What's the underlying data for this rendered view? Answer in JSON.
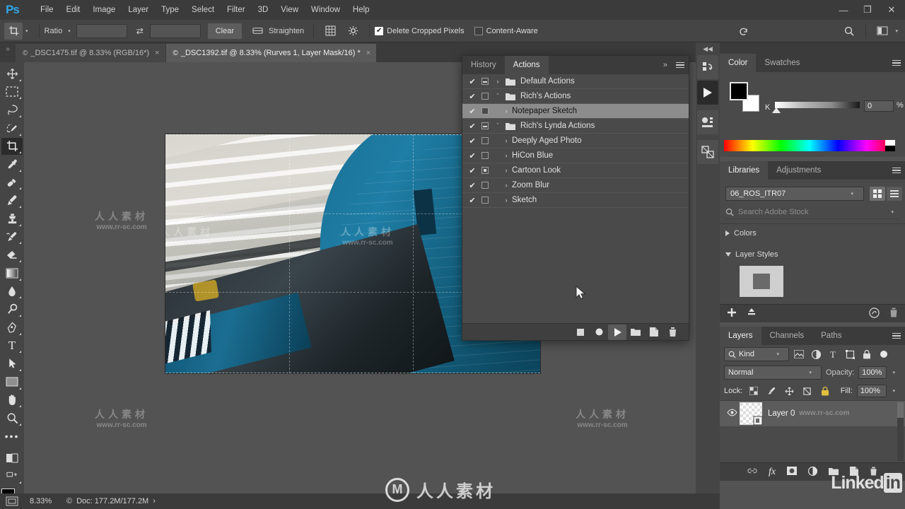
{
  "app": {
    "name": "Adobe Photoshop",
    "logo_text": "Ps"
  },
  "menubar": {
    "items": [
      {
        "label": "File"
      },
      {
        "label": "Edit"
      },
      {
        "label": "Image"
      },
      {
        "label": "Layer"
      },
      {
        "label": "Type"
      },
      {
        "label": "Select"
      },
      {
        "label": "Filter"
      },
      {
        "label": "3D"
      },
      {
        "label": "View"
      },
      {
        "label": "Window"
      },
      {
        "label": "Help"
      }
    ],
    "window_controls": {
      "minimize": "—",
      "restore": "❐",
      "close": "✕"
    }
  },
  "options_bar": {
    "tool_name": "crop-tool",
    "ratio_label": "Ratio",
    "width_value": "",
    "height_value": "",
    "swap_icon": "swap-arrows-icon",
    "clear_label": "Clear",
    "straighten_label": "Straighten",
    "overlay_icon": "crop-overlay-grid-icon",
    "settings_icon": "gear-icon",
    "delete_cropped_label": "Delete Cropped Pixels",
    "delete_cropped_checked": true,
    "content_aware_label": "Content-Aware",
    "content_aware_checked": false,
    "reset_icon": "reset-arrow-icon",
    "search_icon": "search-icon",
    "workspace_icon": "workspace-switcher-icon"
  },
  "tabs": {
    "collapse_icon": "expand-arrows-icon",
    "documents": [
      {
        "title": "_DSC1475.tif @ 8.33% (RGB/16*)",
        "cloud_mark": "©",
        "active": false,
        "close": "×"
      },
      {
        "title": "_DSC1392.tif @ 8.33% (Rurves 1, Layer Mask/16) *",
        "cloud_mark": "©",
        "active": true,
        "close": "×"
      }
    ]
  },
  "toolbox": {
    "tools": [
      {
        "name": "move-tool",
        "active": false
      },
      {
        "name": "rectangular-marquee-tool",
        "active": false
      },
      {
        "name": "lasso-tool",
        "active": false
      },
      {
        "name": "quick-selection-tool",
        "active": false
      },
      {
        "name": "crop-tool",
        "active": true
      },
      {
        "name": "eyedropper-tool",
        "active": false
      },
      {
        "name": "spot-healing-brush-tool",
        "active": false
      },
      {
        "name": "brush-tool",
        "active": false
      },
      {
        "name": "clone-stamp-tool",
        "active": false
      },
      {
        "name": "history-brush-tool",
        "active": false
      },
      {
        "name": "eraser-tool",
        "active": false
      },
      {
        "name": "gradient-tool",
        "active": false
      },
      {
        "name": "blur-tool",
        "active": false
      },
      {
        "name": "dodge-tool",
        "active": false
      },
      {
        "name": "pen-tool",
        "active": false
      },
      {
        "name": "type-tool",
        "active": false
      },
      {
        "name": "path-selection-tool",
        "active": false
      },
      {
        "name": "rectangle-tool",
        "active": false
      },
      {
        "name": "hand-tool",
        "active": false
      },
      {
        "name": "zoom-tool",
        "active": false
      },
      {
        "name": "edit-toolbar-tool",
        "active": false
      }
    ],
    "quickmask_icon": "quick-mask-icon",
    "screenmode_icon": "screen-mode-icon",
    "foreground_color": "#000000",
    "background_color": "#ffffff"
  },
  "actions_panel": {
    "tabs": [
      {
        "label": "History",
        "active": false
      },
      {
        "label": "Actions",
        "active": true
      }
    ],
    "chevrons": "»",
    "menu_icon": "panel-menu-icon",
    "rows": [
      {
        "label": "Default Actions",
        "checked": true,
        "box": "minus",
        "arrow": "›",
        "is_folder": true,
        "expanded": false,
        "highlight": false
      },
      {
        "label": "Rich's Actions",
        "checked": true,
        "box": "empty",
        "arrow": "ˇ",
        "is_folder": true,
        "expanded": true,
        "highlight": false
      },
      {
        "label": "Notepaper Sketch",
        "checked": true,
        "box": "empty",
        "arrow": "›",
        "is_folder": false,
        "expanded": false,
        "highlight": true
      },
      {
        "label": "Rich's Lynda Actions",
        "checked": true,
        "box": "minus",
        "arrow": "ˇ",
        "is_folder": true,
        "expanded": true,
        "highlight": false
      },
      {
        "label": "Deeply Aged Photo",
        "checked": true,
        "box": "empty",
        "arrow": "›",
        "is_folder": false,
        "expanded": false,
        "highlight": false
      },
      {
        "label": "HiCon Blue",
        "checked": true,
        "box": "empty",
        "arrow": "›",
        "is_folder": false,
        "expanded": false,
        "highlight": false
      },
      {
        "label": "Cartoon Look",
        "checked": true,
        "box": "filled",
        "arrow": "›",
        "is_folder": false,
        "expanded": false,
        "highlight": false
      },
      {
        "label": "Zoom Blur",
        "checked": true,
        "box": "empty",
        "arrow": "›",
        "is_folder": false,
        "expanded": false,
        "highlight": false
      },
      {
        "label": "Sketch",
        "checked": true,
        "box": "empty",
        "arrow": "›",
        "is_folder": false,
        "expanded": false,
        "highlight": false
      }
    ],
    "footer_buttons": [
      {
        "name": "stop-recording-button",
        "icon": "stop-square-icon",
        "active": false
      },
      {
        "name": "begin-recording-button",
        "icon": "record-circle-icon",
        "active": false
      },
      {
        "name": "play-selection-button",
        "icon": "play-triangle-icon",
        "active": true
      },
      {
        "name": "create-new-set-button",
        "icon": "folder-icon",
        "active": false
      },
      {
        "name": "create-new-action-button",
        "icon": "new-page-icon",
        "active": false
      },
      {
        "name": "delete-button",
        "icon": "trash-icon",
        "active": false
      }
    ]
  },
  "dock_rail": {
    "collapse_icon": "collapse-double-arrow-icon",
    "buttons": [
      {
        "name": "history-panel-icon",
        "active": false
      },
      {
        "name": "actions-panel-icon",
        "active": true
      },
      {
        "name": "properties-panel-icon",
        "active": false
      },
      {
        "name": "styles-panel-icon",
        "active": false
      }
    ]
  },
  "color_panel": {
    "tabs": [
      {
        "label": "Color",
        "active": true
      },
      {
        "label": "Swatches",
        "active": false
      }
    ],
    "menu_icon": "panel-menu-icon",
    "channel_label": "K",
    "channel_value": "0",
    "percent_symbol": "%",
    "foreground_color": "#000000",
    "background_color": "#ffffff"
  },
  "libraries_panel": {
    "tabs": [
      {
        "label": "Libraries",
        "active": true
      },
      {
        "label": "Adjustments",
        "active": false
      }
    ],
    "menu_icon": "panel-menu-icon",
    "library_name": "06_ROS_ITR07",
    "search_placeholder": "Search Adobe Stock",
    "search_icon": "search-icon",
    "view_grid_icon": "grid-view-icon",
    "view_list_icon": "list-view-icon",
    "groups": [
      {
        "label": "Colors",
        "expanded": false
      },
      {
        "label": "Layer Styles",
        "expanded": true
      }
    ],
    "footer": {
      "add_icon": "plus-icon",
      "upload_icon": "upload-icon",
      "cc_icon": "creative-cloud-icon",
      "delete_icon": "trash-icon"
    }
  },
  "layers_panel": {
    "tabs": [
      {
        "label": "Layers",
        "active": true
      },
      {
        "label": "Channels",
        "active": false
      },
      {
        "label": "Paths",
        "active": false
      }
    ],
    "menu_icon": "panel-menu-icon",
    "filter_label": "Kind",
    "filter_icons": [
      {
        "name": "filter-pixel-icon"
      },
      {
        "name": "filter-adjustment-icon"
      },
      {
        "name": "filter-type-icon"
      },
      {
        "name": "filter-shape-icon"
      },
      {
        "name": "filter-smartobject-icon"
      }
    ],
    "filter_toggle_icon": "filter-power-toggle-icon",
    "blend_mode": "Normal",
    "opacity_label": "Opacity:",
    "opacity_value": "100%",
    "lock_label": "Lock:",
    "lock_icons": [
      {
        "name": "lock-transparent-pixels-icon"
      },
      {
        "name": "lock-image-pixels-icon"
      },
      {
        "name": "lock-position-icon"
      },
      {
        "name": "lock-artboard-nesting-icon"
      },
      {
        "name": "lock-all-icon"
      }
    ],
    "fill_label": "Fill:",
    "fill_value": "100%",
    "layers": [
      {
        "name": "Layer 0",
        "visible": true,
        "selected": true,
        "thumb": "transparent-checker"
      }
    ],
    "footer_buttons": [
      {
        "name": "link-layers-button",
        "icon": "link-icon"
      },
      {
        "name": "layer-style-button",
        "icon": "fx-icon"
      },
      {
        "name": "add-layer-mask-button",
        "icon": "mask-icon"
      },
      {
        "name": "new-adjustment-layer-button",
        "icon": "half-circle-icon"
      },
      {
        "name": "new-group-button",
        "icon": "folder-icon"
      },
      {
        "name": "new-layer-button",
        "icon": "new-page-icon"
      },
      {
        "name": "delete-layer-button",
        "icon": "trash-icon"
      }
    ]
  },
  "status_bar": {
    "screen_mode_icon": "screen-mode-icon",
    "zoom_level": "8.33%",
    "cloud_mark": "©",
    "doc_info": "Doc: 177.2M/177.2M",
    "expand_arrow": "›"
  },
  "canvas": {
    "document_name": "_DSC1392.tif",
    "subject": "blue navy warbird aircraft tail inside hangar",
    "crop_active": true,
    "cursor_position": "mouse pointer over actions panel"
  },
  "watermarks": {
    "site_url": "www.rr-sc.com",
    "site_cn": "人人素材",
    "banner_url": "www.rr-sc.com",
    "brand_mark": "M",
    "linkedin_text": "Linked",
    "linkedin_badge": "in"
  },
  "colors": {
    "chrome_dark": "#3b3b3b",
    "chrome_mid": "#454545",
    "panel_bg": "#4a4a4a",
    "canvas_bg": "#535353",
    "accent_blue": "#2da7e6",
    "highlight_row": "#8c8c8c"
  }
}
